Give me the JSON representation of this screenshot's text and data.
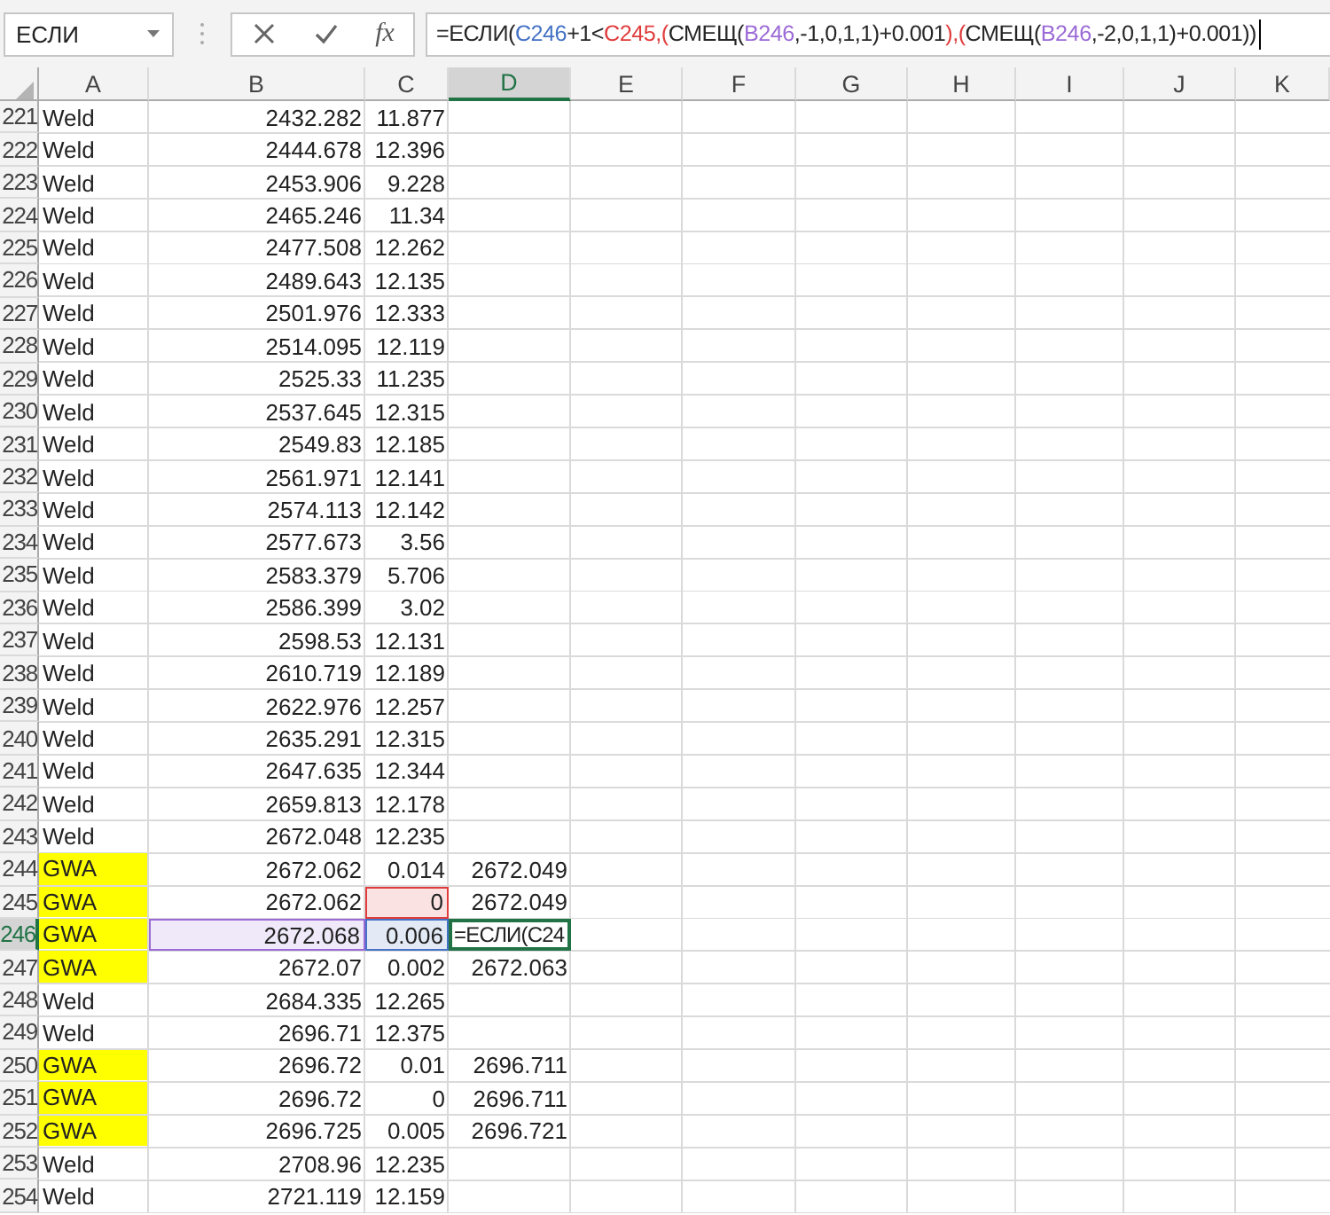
{
  "name_box": {
    "value": "ЕСЛИ"
  },
  "formula_bar": {
    "function_label": "fx",
    "segments": [
      {
        "text": "=ЕСЛИ(",
        "color": "#262626"
      },
      {
        "text": "C246",
        "color": "#4472c4"
      },
      {
        "text": "+1<",
        "color": "#262626"
      },
      {
        "text": "C245",
        "color": "#e03c3c"
      },
      {
        "text": ",(",
        "color": "#e03c3c"
      },
      {
        "text": "СМЕЩ(",
        "color": "#262626"
      },
      {
        "text": "B246",
        "color": "#9b6ad6"
      },
      {
        "text": ",-1,0,1,1)+0.001",
        "color": "#262626"
      },
      {
        "text": "),(",
        "color": "#e03c3c"
      },
      {
        "text": "СМЕЩ(",
        "color": "#262626"
      },
      {
        "text": "B246",
        "color": "#9b6ad6"
      },
      {
        "text": ",-2,0,1,1)+0.001))",
        "color": "#262626"
      }
    ]
  },
  "columns": [
    {
      "label": "A",
      "selected": false
    },
    {
      "label": "B",
      "selected": false
    },
    {
      "label": "C",
      "selected": false
    },
    {
      "label": "D",
      "selected": true
    },
    {
      "label": "E",
      "selected": false
    },
    {
      "label": "F",
      "selected": false
    },
    {
      "label": "G",
      "selected": false
    },
    {
      "label": "H",
      "selected": false
    },
    {
      "label": "I",
      "selected": false
    },
    {
      "label": "J",
      "selected": false
    },
    {
      "label": "K",
      "selected": false
    }
  ],
  "rows": [
    {
      "number": "221",
      "cells": [
        "Weld",
        "2432.282",
        "11.877",
        ""
      ],
      "highlighted": false,
      "selected": false
    },
    {
      "number": "222",
      "cells": [
        "Weld",
        "2444.678",
        "12.396",
        ""
      ],
      "highlighted": false,
      "selected": false
    },
    {
      "number": "223",
      "cells": [
        "Weld",
        "2453.906",
        "9.228",
        ""
      ],
      "highlighted": false,
      "selected": false
    },
    {
      "number": "224",
      "cells": [
        "Weld",
        "2465.246",
        "11.34",
        ""
      ],
      "highlighted": false,
      "selected": false
    },
    {
      "number": "225",
      "cells": [
        "Weld",
        "2477.508",
        "12.262",
        ""
      ],
      "highlighted": false,
      "selected": false
    },
    {
      "number": "226",
      "cells": [
        "Weld",
        "2489.643",
        "12.135",
        ""
      ],
      "highlighted": false,
      "selected": false
    },
    {
      "number": "227",
      "cells": [
        "Weld",
        "2501.976",
        "12.333",
        ""
      ],
      "highlighted": false,
      "selected": false
    },
    {
      "number": "228",
      "cells": [
        "Weld",
        "2514.095",
        "12.119",
        ""
      ],
      "highlighted": false,
      "selected": false
    },
    {
      "number": "229",
      "cells": [
        "Weld",
        "2525.33",
        "11.235",
        ""
      ],
      "highlighted": false,
      "selected": false
    },
    {
      "number": "230",
      "cells": [
        "Weld",
        "2537.645",
        "12.315",
        ""
      ],
      "highlighted": false,
      "selected": false
    },
    {
      "number": "231",
      "cells": [
        "Weld",
        "2549.83",
        "12.185",
        ""
      ],
      "highlighted": false,
      "selected": false
    },
    {
      "number": "232",
      "cells": [
        "Weld",
        "2561.971",
        "12.141",
        ""
      ],
      "highlighted": false,
      "selected": false
    },
    {
      "number": "233",
      "cells": [
        "Weld",
        "2574.113",
        "12.142",
        ""
      ],
      "highlighted": false,
      "selected": false
    },
    {
      "number": "234",
      "cells": [
        "Weld",
        "2577.673",
        "3.56",
        ""
      ],
      "highlighted": false,
      "selected": false
    },
    {
      "number": "235",
      "cells": [
        "Weld",
        "2583.379",
        "5.706",
        ""
      ],
      "highlighted": false,
      "selected": false
    },
    {
      "number": "236",
      "cells": [
        "Weld",
        "2586.399",
        "3.02",
        ""
      ],
      "highlighted": false,
      "selected": false
    },
    {
      "number": "237",
      "cells": [
        "Weld",
        "2598.53",
        "12.131",
        ""
      ],
      "highlighted": false,
      "selected": false
    },
    {
      "number": "238",
      "cells": [
        "Weld",
        "2610.719",
        "12.189",
        ""
      ],
      "highlighted": false,
      "selected": false
    },
    {
      "number": "239",
      "cells": [
        "Weld",
        "2622.976",
        "12.257",
        ""
      ],
      "highlighted": false,
      "selected": false
    },
    {
      "number": "240",
      "cells": [
        "Weld",
        "2635.291",
        "12.315",
        ""
      ],
      "highlighted": false,
      "selected": false
    },
    {
      "number": "241",
      "cells": [
        "Weld",
        "2647.635",
        "12.344",
        ""
      ],
      "highlighted": false,
      "selected": false
    },
    {
      "number": "242",
      "cells": [
        "Weld",
        "2659.813",
        "12.178",
        ""
      ],
      "highlighted": false,
      "selected": false
    },
    {
      "number": "243",
      "cells": [
        "Weld",
        "2672.048",
        "12.235",
        ""
      ],
      "highlighted": false,
      "selected": false
    },
    {
      "number": "244",
      "cells": [
        "GWA",
        "2672.062",
        "0.014",
        "2672.049"
      ],
      "highlighted": true,
      "selected": false
    },
    {
      "number": "245",
      "cells": [
        "GWA",
        "2672.062",
        {
          "text": "0",
          "color": "#e03c3c"
        },
        "2672.049"
      ],
      "highlighted": true,
      "selected": false
    },
    {
      "number": "246",
      "cells": [
        {
          "text": "GWA",
          "active": false
        },
        {
          "text": "2672.068",
          "active": false,
          "color": "#9b6ad6"
        },
        {
          "text": "0.006",
          "active": false,
          "color": "#4472c4"
        },
        {
          "text": "=ЕСЛИ(C24",
          "active": true
        }
      ],
      "highlighted": true,
      "selected": true
    },
    {
      "number": "247",
      "cells": [
        "GWA",
        "2672.07",
        "0.002",
        "2672.063"
      ],
      "highlighted": true,
      "selected": false
    },
    {
      "number": "248",
      "cells": [
        "Weld",
        "2684.335",
        "12.265",
        ""
      ],
      "highlighted": false,
      "selected": false
    },
    {
      "number": "249",
      "cells": [
        "Weld",
        "2696.71",
        "12.375",
        ""
      ],
      "highlighted": false,
      "selected": false
    },
    {
      "number": "250",
      "cells": [
        "GWA",
        "2696.72",
        "0.01",
        "2696.711"
      ],
      "highlighted": true,
      "selected": false
    },
    {
      "number": "251",
      "cells": [
        "GWA",
        "2696.72",
        "0",
        "2696.711"
      ],
      "highlighted": true,
      "selected": false
    },
    {
      "number": "252",
      "cells": [
        "GWA",
        "2696.725",
        "0.005",
        "2696.721"
      ],
      "highlighted": true,
      "selected": false
    },
    {
      "number": "253",
      "cells": [
        "Weld",
        "2708.96",
        "12.235",
        ""
      ],
      "highlighted": false,
      "selected": false
    },
    {
      "number": "254",
      "cells": [
        "Weld",
        "2721.119",
        "12.159",
        ""
      ],
      "highlighted": false,
      "selected": false
    }
  ]
}
